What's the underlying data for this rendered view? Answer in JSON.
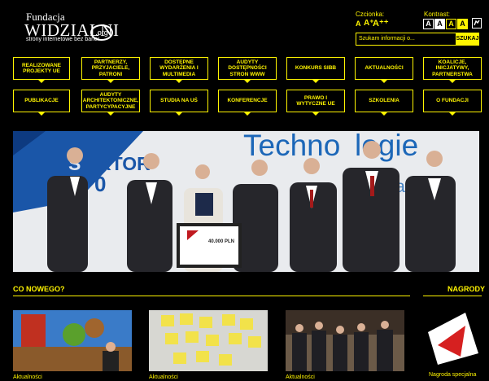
{
  "logo": {
    "line1": "Fundacja",
    "name": "WIDZIALNI",
    "org": ".org",
    "tagline": "strony internetowe bez barier"
  },
  "font_size": {
    "label": "Czcionka:",
    "options": [
      "A",
      "A⁺",
      "A⁺⁺"
    ]
  },
  "contrast": {
    "label": "Kontrast:",
    "options": [
      "A",
      "A",
      "A",
      "A"
    ]
  },
  "search": {
    "placeholder": "Szukam informacji o...",
    "button": "SZUKAJ"
  },
  "nav": [
    "REALIZOWANE PROJEKTY UE",
    "PARTNERZY, PRZYJACIELE, PATRONI",
    "DOSTĘPNE WYDARZENIA I MULTIMEDIA",
    "AUDYTY DOSTĘPNOŚCI STRON WWW",
    "KONKURS SIBB",
    "AKTUALNOŚCI",
    "KOALICJE, INICJATYWY, PARTNERSTWA",
    "PUBLIKACJE",
    "AUDYTY ARCHITEKTONICZNE, PARTYCYPACYJNE",
    "STUDIA NA UŚ",
    "KONFERENCJE",
    "PRAWO I WYTYCZNE UE",
    "SZKOLENIA",
    "O FUNDACJI"
  ],
  "hero": {
    "banner_word": "Technologie",
    "sektor": "SEKTOR 3.0",
    "cheque": "40.000 PLN"
  },
  "sections": {
    "news": "CO NOWEGO?",
    "awards": "NAGRODY"
  },
  "news_items": [
    {
      "caption": "Aktualności"
    },
    {
      "caption": "Aktualności"
    },
    {
      "caption": "Aktualności"
    }
  ],
  "award": {
    "caption": "Nagroda specjalna"
  },
  "colors": {
    "accent": "#fff500",
    "background": "#000000"
  }
}
